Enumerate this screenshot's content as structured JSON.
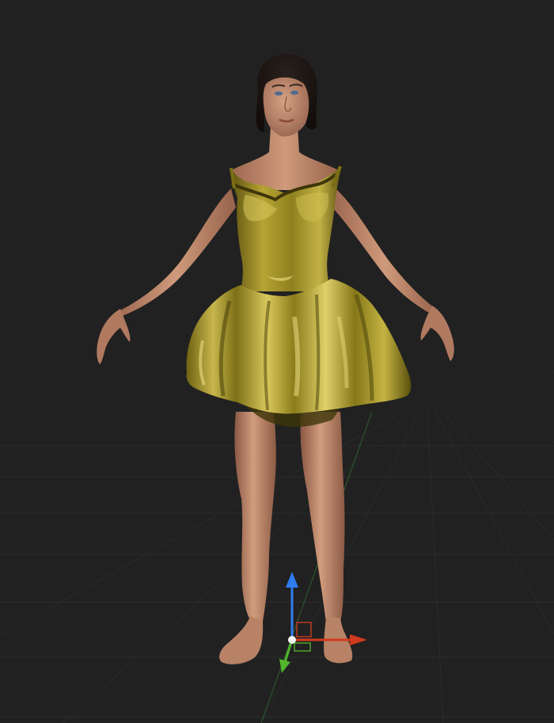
{
  "viewport": {
    "background_color": "#212121",
    "grid_color": "#2f3431",
    "grid_axis_color": "#2e5a2e"
  },
  "model": {
    "skin_color": "#c79071",
    "skin_shadow_color": "#8f5c45",
    "hair_color": "#1a1412",
    "dress_color": "#9a8a18",
    "dress_highlight_color": "#e6d36a",
    "dress_shadow_color": "#5a4f0c"
  },
  "gizmo": {
    "icon": "transform-gizmo-icon",
    "x_axis_color": "#d03a1f",
    "y_axis_color": "#2f7df0",
    "z_axis_color": "#52b52c"
  }
}
